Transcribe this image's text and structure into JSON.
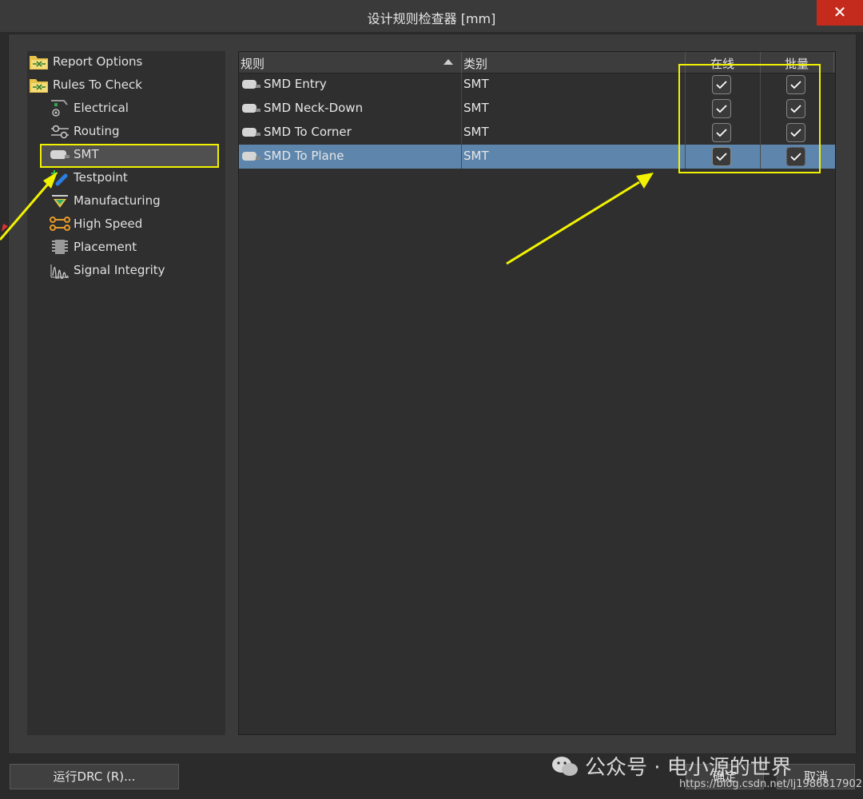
{
  "window": {
    "title": "设计规则检查器 [mm]",
    "close_label": "✕"
  },
  "tree": {
    "items": [
      {
        "label": "Report Options",
        "icon": "folder-check-icon"
      },
      {
        "label": "Rules To Check",
        "icon": "folder-check-icon"
      },
      {
        "label": "Electrical",
        "icon": "electrical-icon"
      },
      {
        "label": "Routing",
        "icon": "routing-icon"
      },
      {
        "label": "SMT",
        "icon": "smt-icon",
        "selected": true
      },
      {
        "label": "Testpoint",
        "icon": "testpoint-icon"
      },
      {
        "label": "Manufacturing",
        "icon": "manufacturing-icon"
      },
      {
        "label": "High Speed",
        "icon": "high-speed-icon"
      },
      {
        "label": "Placement",
        "icon": "placement-icon"
      },
      {
        "label": "Signal Integrity",
        "icon": "signal-integrity-icon"
      }
    ]
  },
  "table": {
    "headers": {
      "rule": "规则",
      "category": "类别",
      "online": "在线",
      "batch": "批量"
    },
    "rows": [
      {
        "rule": "SMD Entry",
        "category": "SMT",
        "online": true,
        "batch": true
      },
      {
        "rule": "SMD Neck-Down",
        "category": "SMT",
        "online": true,
        "batch": true
      },
      {
        "rule": "SMD To Corner",
        "category": "SMT",
        "online": true,
        "batch": true
      },
      {
        "rule": "SMD To Plane",
        "category": "SMT",
        "online": true,
        "batch": true,
        "selected": true
      }
    ]
  },
  "buttons": {
    "run_drc": "运行DRC (R)...",
    "ok": "确定",
    "cancel": "取消"
  },
  "watermark": {
    "text": "公众号 · 电小源的世界",
    "url": "https://blog.csdn.net/lj1986817902"
  },
  "colors": {
    "highlight": "#f2f200",
    "selected_row": "#5e86ad",
    "close": "#c42b1c"
  }
}
